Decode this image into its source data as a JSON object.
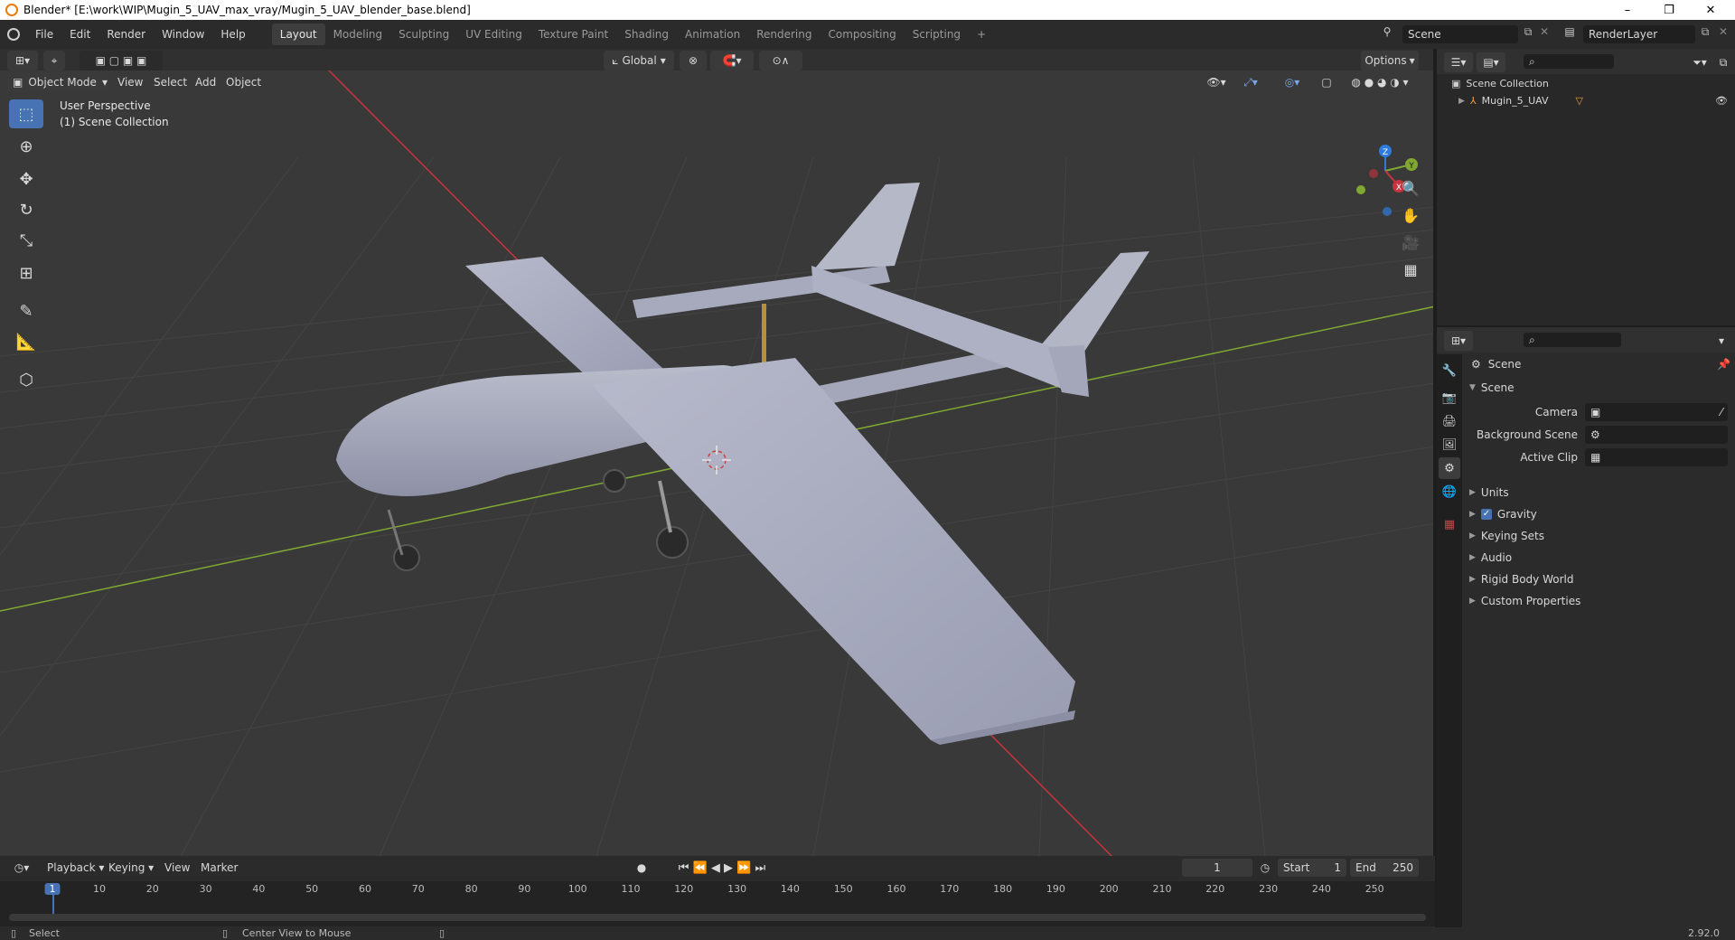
{
  "window": {
    "title": "Blender* [E:\\work\\WIP\\Mugin_5_UAV_max_vray/Mugin_5_UAV_blender_base.blend]",
    "controls": [
      "–",
      "❐",
      "✕"
    ]
  },
  "menubar": {
    "menus": [
      "File",
      "Edit",
      "Render",
      "Window",
      "Help"
    ],
    "workspaces": [
      "Layout",
      "Modeling",
      "Sculpting",
      "UV Editing",
      "Texture Paint",
      "Shading",
      "Animation",
      "Rendering",
      "Compositing",
      "Scripting"
    ],
    "active_workspace": "Layout",
    "add_workspace": "+",
    "scene_name": "Scene",
    "render_layer": "RenderLayer"
  },
  "viewport": {
    "orientation": "Global",
    "options_label": "Options",
    "mode": "Object Mode",
    "menus": [
      "View",
      "Select",
      "Add",
      "Object"
    ],
    "overlay_line1": "User Perspective",
    "overlay_line2": "(1) Scene Collection",
    "gizmo_axes": {
      "z": "Z",
      "y": "Y",
      "x": "X"
    },
    "colors": {
      "x_axis": "#c8343e",
      "y_axis": "#7fa832",
      "z_axis": "#2e7bdb",
      "grid": "#444444",
      "background": "#393939"
    }
  },
  "outliner": {
    "root": "Scene Collection",
    "items": [
      {
        "name": "Mugin_5_UAV"
      }
    ]
  },
  "properties": {
    "context": "Scene",
    "section": "Scene",
    "fields": [
      {
        "label": "Camera",
        "value": ""
      },
      {
        "label": "Background Scene",
        "value": ""
      },
      {
        "label": "Active Clip",
        "value": ""
      }
    ],
    "panels": [
      "Units",
      "Gravity",
      "Keying Sets",
      "Audio",
      "Rigid Body World",
      "Custom Properties"
    ],
    "gravity_checked": true
  },
  "timeline": {
    "menus": [
      "Playback",
      "Keying",
      "View",
      "Marker"
    ],
    "current_frame": "1",
    "start_label": "Start",
    "start": "1",
    "end_label": "End",
    "end": "250",
    "ticks": [
      "1",
      "10",
      "20",
      "30",
      "40",
      "50",
      "60",
      "70",
      "80",
      "90",
      "100",
      "110",
      "120",
      "130",
      "140",
      "150",
      "160",
      "170",
      "180",
      "190",
      "200",
      "210",
      "220",
      "230",
      "240",
      "250"
    ]
  },
  "statusbar": {
    "left": "Select",
    "middle": "Center View to Mouse",
    "version": "2.92.0"
  }
}
